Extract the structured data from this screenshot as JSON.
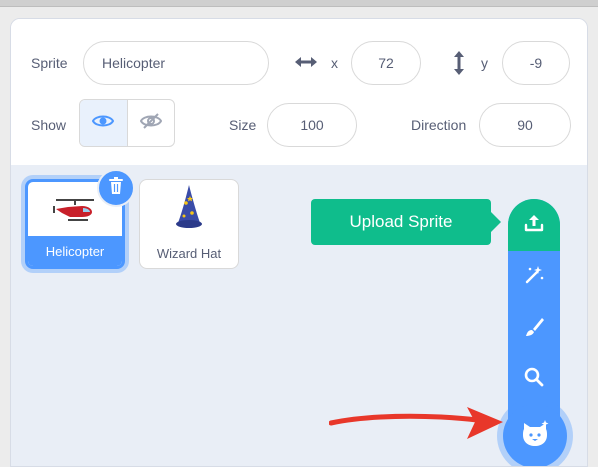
{
  "sprite_info": {
    "sprite_label": "Sprite",
    "sprite_name": "Helicopter",
    "x_label": "x",
    "x_value": "72",
    "y_label": "y",
    "y_value": "-9",
    "show_label": "Show",
    "size_label": "Size",
    "size_value": "100",
    "direction_label": "Direction",
    "direction_value": "90"
  },
  "sprites": [
    {
      "name": "Helicopter",
      "selected": true,
      "icon": "helicopter-icon"
    },
    {
      "name": "Wizard Hat",
      "selected": false,
      "icon": "wizard-hat-icon"
    }
  ],
  "menu": {
    "upload_tooltip": "Upload Sprite",
    "items": [
      "upload-icon",
      "surprise-icon",
      "paint-icon",
      "search-icon",
      "choose-sprite-icon"
    ]
  },
  "colors": {
    "accent": "#4c97ff",
    "upload_green": "#0fbd8c",
    "annotation_arrow": "#e8372a",
    "text": "#575e75"
  }
}
